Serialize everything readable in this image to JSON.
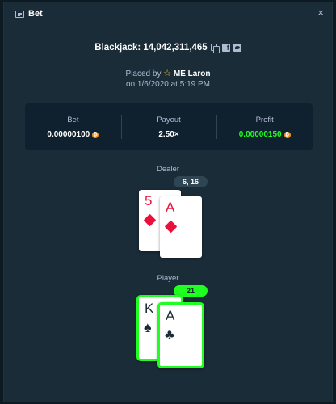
{
  "header": {
    "title": "Bet",
    "close_glyph": "×"
  },
  "game": {
    "label": "Blackjack: 14,042,311,465"
  },
  "placed": {
    "prefix": "Placed by",
    "user": "ME Laron",
    "date_line": "on 1/6/2020 at 5:19 PM"
  },
  "stats": {
    "bet_label": "Bet",
    "bet_value": "0.00000100",
    "payout_label": "Payout",
    "payout_value": "2.50×",
    "profit_label": "Profit",
    "profit_value": "0.00000150"
  },
  "dealer": {
    "label": "Dealer",
    "score": "6, 16",
    "cards": [
      {
        "rank": "5",
        "suit": "diamond"
      },
      {
        "rank": "A",
        "suit": "diamond"
      }
    ]
  },
  "player": {
    "label": "Player",
    "score": "21",
    "cards": [
      {
        "rank": "K",
        "suit": "spade"
      },
      {
        "rank": "A",
        "suit": "club"
      }
    ]
  },
  "colors": {
    "background": "#1a2c38",
    "panel": "#0f212e",
    "win_green": "#1fff20",
    "card_red": "#e9113c",
    "coin": "#f7931a"
  }
}
